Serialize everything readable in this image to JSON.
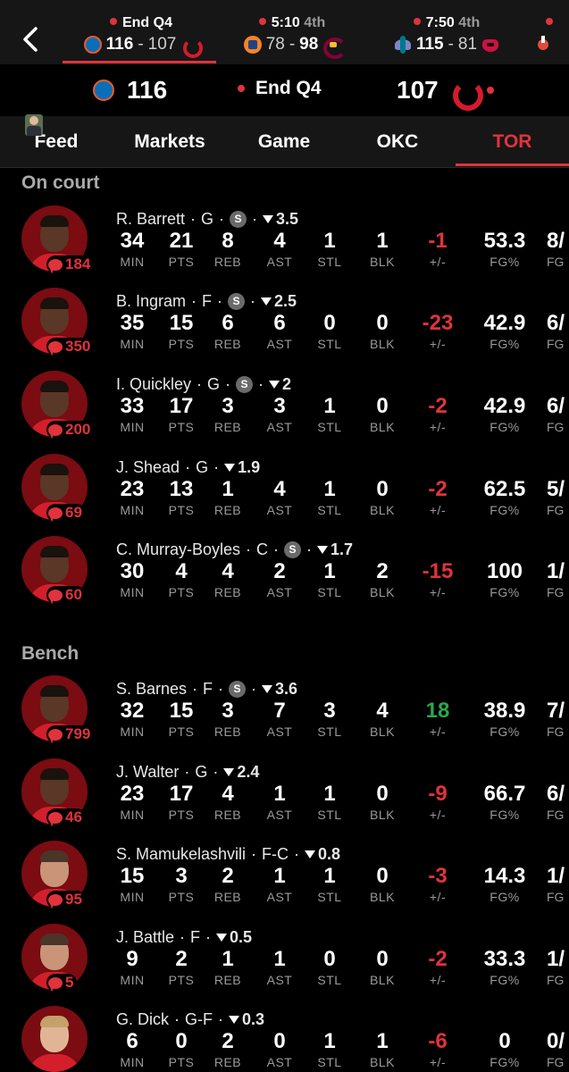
{
  "games_strip": {
    "games": [
      {
        "status": "End Q4",
        "quarter": "",
        "home_logo": "okc-thunder-logo",
        "away_logo": "toronto-raptors-logo",
        "score_left": "116",
        "score_right": "107",
        "left_bold": true
      },
      {
        "status": "5:10",
        "quarter": "4th",
        "home_logo": "new-york-knicks-logo",
        "away_logo": "cleveland-cavaliers-logo",
        "score_left": "78",
        "score_right": "98",
        "left_bold": false
      },
      {
        "status": "7:50",
        "quarter": "4th",
        "home_logo": "charlotte-hornets-logo",
        "away_logo": "chicago-bulls-logo",
        "score_left": "115",
        "score_right": "81",
        "left_bold": true
      },
      {
        "status": "",
        "quarter": "",
        "home_logo": "miami-heat-logo",
        "away_logo": "",
        "score_left": "",
        "score_right": "",
        "left_bold": false
      }
    ]
  },
  "scoreboard": {
    "left_score": "116",
    "status": "End Q4",
    "right_score": "107"
  },
  "tabs": [
    "Feed",
    "Markets",
    "Game",
    "OKC",
    "TOR"
  ],
  "active_tab": "TOR",
  "stat_labels": [
    "MIN",
    "PTS",
    "REB",
    "AST",
    "STL",
    "BLK",
    "+/-",
    "FG%",
    "FG"
  ],
  "sections": {
    "on_court": "On court",
    "bench": "Bench"
  },
  "players": [
    {
      "name": "R. Barrett",
      "pos": "G",
      "starter": true,
      "rating": "3.5",
      "comments": "184",
      "min": "34",
      "pts": "21",
      "reb": "8",
      "ast": "4",
      "stl": "1",
      "blk": "1",
      "pm": "-1",
      "fgp": "53.3",
      "fg": "8/"
    },
    {
      "name": "B. Ingram",
      "pos": "F",
      "starter": true,
      "rating": "2.5",
      "comments": "350",
      "min": "35",
      "pts": "15",
      "reb": "6",
      "ast": "6",
      "stl": "0",
      "blk": "0",
      "pm": "-23",
      "fgp": "42.9",
      "fg": "6/"
    },
    {
      "name": "I. Quickley",
      "pos": "G",
      "starter": true,
      "rating": "2",
      "comments": "200",
      "min": "33",
      "pts": "17",
      "reb": "3",
      "ast": "3",
      "stl": "1",
      "blk": "0",
      "pm": "-2",
      "fgp": "42.9",
      "fg": "6/"
    },
    {
      "name": "J. Shead",
      "pos": "G",
      "starter": false,
      "rating": "1.9",
      "comments": "69",
      "min": "23",
      "pts": "13",
      "reb": "1",
      "ast": "4",
      "stl": "1",
      "blk": "0",
      "pm": "-2",
      "fgp": "62.5",
      "fg": "5/"
    },
    {
      "name": "C. Murray-Boyles",
      "pos": "C",
      "starter": true,
      "rating": "1.7",
      "comments": "60",
      "min": "30",
      "pts": "4",
      "reb": "4",
      "ast": "2",
      "stl": "1",
      "blk": "2",
      "pm": "-15",
      "fgp": "100",
      "fg": "1/"
    },
    {
      "name": "S. Barnes",
      "pos": "F",
      "starter": true,
      "rating": "3.6",
      "comments": "799",
      "min": "32",
      "pts": "15",
      "reb": "3",
      "ast": "7",
      "stl": "3",
      "blk": "4",
      "pm": "18",
      "fgp": "38.9",
      "fg": "7/"
    },
    {
      "name": "J. Walter",
      "pos": "G",
      "starter": false,
      "rating": "2.4",
      "comments": "46",
      "min": "23",
      "pts": "17",
      "reb": "4",
      "ast": "1",
      "stl": "1",
      "blk": "0",
      "pm": "-9",
      "fgp": "66.7",
      "fg": "6/"
    },
    {
      "name": "S. Mamukelashvili",
      "pos": "F-C",
      "starter": false,
      "rating": "0.8",
      "comments": "95",
      "min": "15",
      "pts": "3",
      "reb": "2",
      "ast": "1",
      "stl": "1",
      "blk": "0",
      "pm": "-3",
      "fgp": "14.3",
      "fg": "1/"
    },
    {
      "name": "J. Battle",
      "pos": "F",
      "starter": false,
      "rating": "0.5",
      "comments": "5",
      "min": "9",
      "pts": "2",
      "reb": "1",
      "ast": "1",
      "stl": "0",
      "blk": "0",
      "pm": "-2",
      "fgp": "33.3",
      "fg": "1/"
    },
    {
      "name": "G. Dick",
      "pos": "G-F",
      "starter": false,
      "rating": "0.3",
      "comments": "",
      "min": "6",
      "pts": "0",
      "reb": "2",
      "ast": "0",
      "stl": "1",
      "blk": "1",
      "pm": "-6",
      "fgp": "0",
      "fg": "0/"
    }
  ],
  "colors": {
    "accent": "#e0333c",
    "positive": "#2aa84a",
    "bg": "#000000",
    "strip": "#161616"
  }
}
